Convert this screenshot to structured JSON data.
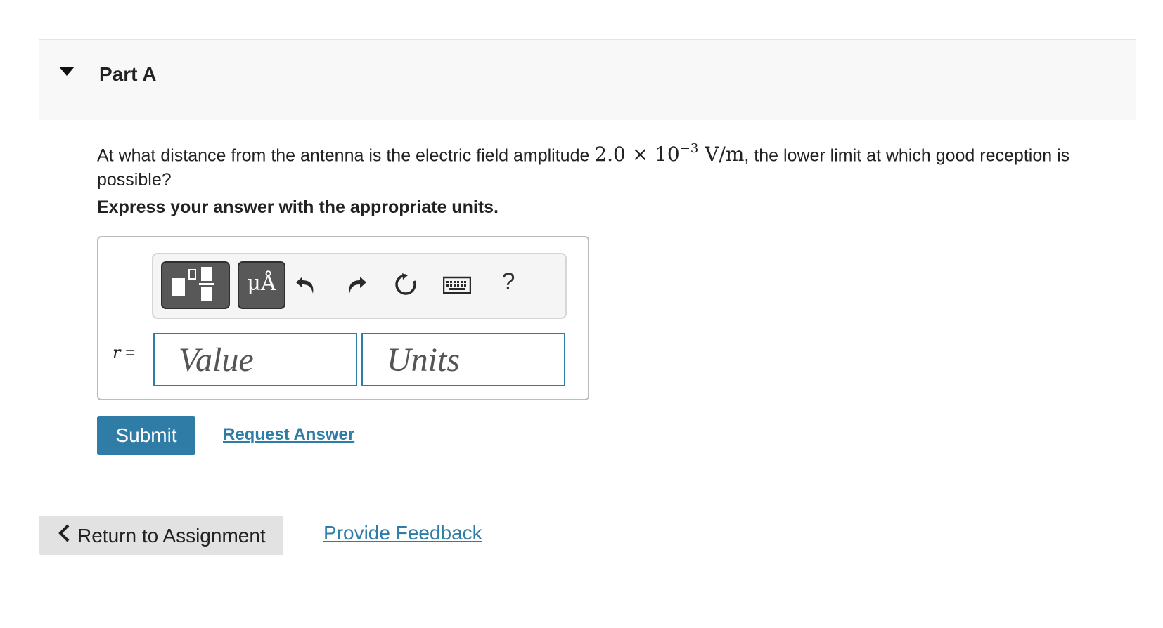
{
  "part": {
    "title": "Part A",
    "toggle_icon": "caret-down-icon"
  },
  "question": {
    "text_before": "At what distance from the antenna is the electric field amplitude ",
    "math_mantissa": "2.0 × 10",
    "math_exponent": "−3",
    "math_unit": " V/m",
    "text_after": ", the lower limit at which good reception is possible?"
  },
  "instruction": "Express your answer with the appropriate units.",
  "toolbar": {
    "templates_icon": "templates-icon",
    "units_label": "μÅ",
    "undo_icon": "undo-icon",
    "redo_icon": "redo-icon",
    "reset_icon": "reset-icon",
    "keyboard_icon": "keyboard-icon",
    "help_label": "?"
  },
  "answer": {
    "variable": "r",
    "equals": " =",
    "value_placeholder": "Value",
    "units_placeholder": "Units"
  },
  "actions": {
    "submit_label": "Submit",
    "request_answer_label": "Request Answer"
  },
  "footer": {
    "return_label": "Return to Assignment",
    "feedback_label": "Provide Feedback"
  },
  "colors": {
    "accent": "#2f7ca6",
    "header_bg": "#f8f8f8",
    "button_gray": "#e2e2e2"
  }
}
